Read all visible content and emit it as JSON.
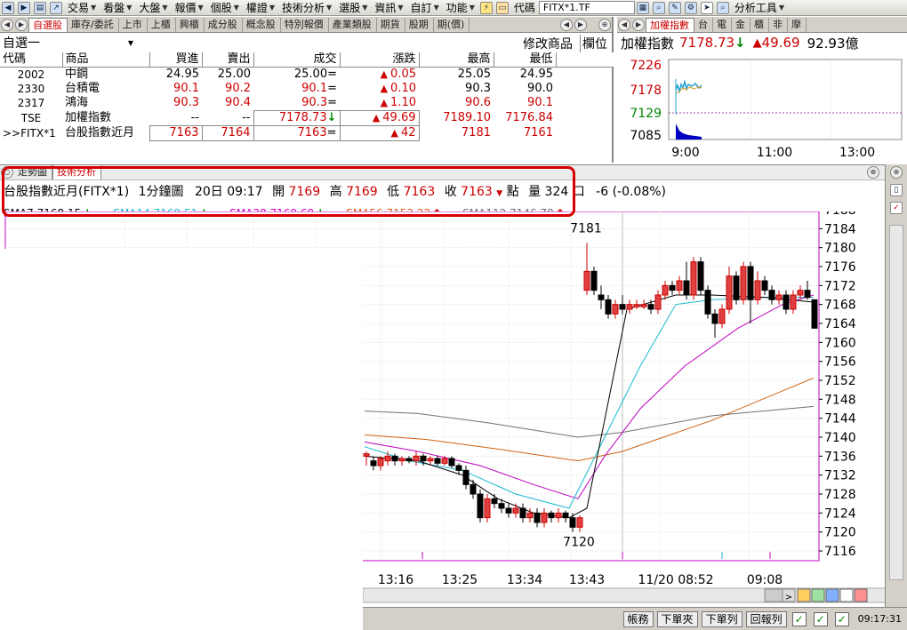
{
  "menubar": {
    "items": [
      "交易",
      "看盤",
      "大盤",
      "報價",
      "個股",
      "權證",
      "技術分析",
      "選股",
      "資訊",
      "自訂",
      "功能"
    ],
    "symbol_label": "代碼",
    "symbol_value": "FITX*1.TF",
    "analysis_tools": "分析工具"
  },
  "watchlist": {
    "tabs": [
      "自選股",
      "庫存/委託",
      "上市",
      "上櫃",
      "興櫃",
      "成分股",
      "概念股",
      "特別報價",
      "產業類股",
      "期貨",
      "股期",
      "期(價)"
    ],
    "active_tab": 0,
    "group_name": "自選一",
    "modify_label": "修改商品",
    "columns_label": "欄位",
    "headers": [
      "代碼",
      "商品",
      "買進",
      "賣出",
      "成交",
      "漲跌",
      "最高",
      "最低"
    ],
    "rows": [
      {
        "code": "2002",
        "name": "中鋼",
        "bid": "24.95",
        "ask": "25.00",
        "last": "25.00",
        "chg": "0.05",
        "high": "25.05",
        "low": "24.95"
      },
      {
        "code": "2330",
        "name": "台積電",
        "bid": "90.1",
        "ask": "90.2",
        "last": "90.1",
        "chg": "0.10",
        "high": "90.3",
        "low": "90.0"
      },
      {
        "code": "2317",
        "name": "鴻海",
        "bid": "90.3",
        "ask": "90.4",
        "last": "90.3",
        "chg": "1.10",
        "high": "90.6",
        "low": "90.1"
      },
      {
        "code": "TSE",
        "name": "加權指數",
        "bid": "--",
        "ask": "--",
        "last": "7178.73",
        "chg": "49.69",
        "high": "7189.10",
        "low": "7176.84"
      },
      {
        "code": ">>FITX*1",
        "name": "台股指數近月",
        "bid": "7163",
        "ask": "7164",
        "last": "7163",
        "chg": "42",
        "high": "7181",
        "low": "7161"
      }
    ]
  },
  "index_panel": {
    "tabs": [
      "加權指數",
      "台",
      "電",
      "金",
      "櫃",
      "非",
      "摩"
    ],
    "title": "加權指數",
    "value": "7178.73",
    "change": "49.69",
    "volume": "92.93億",
    "y_ticks": [
      "7226",
      "7178",
      "7129",
      "7085"
    ],
    "x_ticks": [
      "9:00",
      "11:00",
      "13:00"
    ]
  },
  "tech": {
    "tabs": [
      "走勢圖",
      "技術分析"
    ],
    "product": "台股指數近月(FITX*1)",
    "period": "1分鐘圖",
    "datetime": "20日 09:17",
    "open_label": "開",
    "open": "7169",
    "high_label": "高",
    "high": "7169",
    "low_label": "低",
    "low": "7163",
    "close_label": "收",
    "close": "7163",
    "point_label": "點",
    "vol_label": "量",
    "volume": "324 口",
    "change": "-6 (-0.08%)",
    "sma": [
      {
        "label": "SMA7 7168.15",
        "color": "#000000"
      },
      {
        "label": "SMA14 7169.51",
        "color": "#19b8d0"
      },
      {
        "label": "SMA28 7169.69",
        "color": "#c000c0"
      },
      {
        "label": "SMA56 7153.22",
        "color": "#d06010"
      },
      {
        "label": "SMA112 7146.78",
        "color": "#707070"
      }
    ]
  },
  "chart_data": {
    "type": "candlestick",
    "y_ticks": [
      7188,
      7184,
      7180,
      7176,
      7172,
      7168,
      7164,
      7160,
      7156,
      7152,
      7148,
      7144,
      7140,
      7136,
      7132,
      7128,
      7124,
      7120,
      7116
    ],
    "ylim": [
      7114,
      7190
    ],
    "x_ticks": [
      "13:16",
      "13:25",
      "13:34",
      "13:43",
      "11/20 08:52",
      "09:08"
    ],
    "annotations": [
      {
        "text": "7181",
        "value": 7181
      },
      {
        "text": "7120",
        "value": 7120
      }
    ]
  },
  "statusbar": {
    "buttons": [
      "帳務",
      "下單夾",
      "下單列",
      "回報列"
    ],
    "time": "09:17:31"
  },
  "colors": {
    "up": "#cc0000",
    "down": "#000000",
    "highlight_box": "#d80000"
  }
}
